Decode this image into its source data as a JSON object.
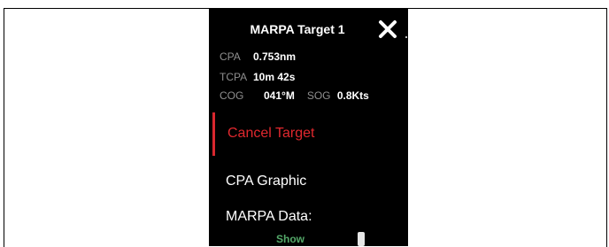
{
  "dialog": {
    "title": "MARPA Target 1",
    "close_icon": "close-icon"
  },
  "target_data": {
    "cpa_label": "CPA",
    "cpa_value": "0.753nm",
    "tcpa_label": "TCPA",
    "tcpa_value": "10m 42s",
    "cog_label": "COG",
    "cog_value": "041°M",
    "sog_label": "SOG",
    "sog_value": "0.8Kts"
  },
  "menu": {
    "cancel_target": "Cancel Target",
    "cpa_graphic": "CPA Graphic",
    "marpa_data": "MARPA Data:",
    "marpa_data_value": "Show"
  },
  "colors": {
    "panel_bg": "#000000",
    "cancel_red": "#e0282e",
    "accent_red": "#d9272e",
    "label_gray": "#8f8f8f",
    "show_green": "#54a869"
  }
}
